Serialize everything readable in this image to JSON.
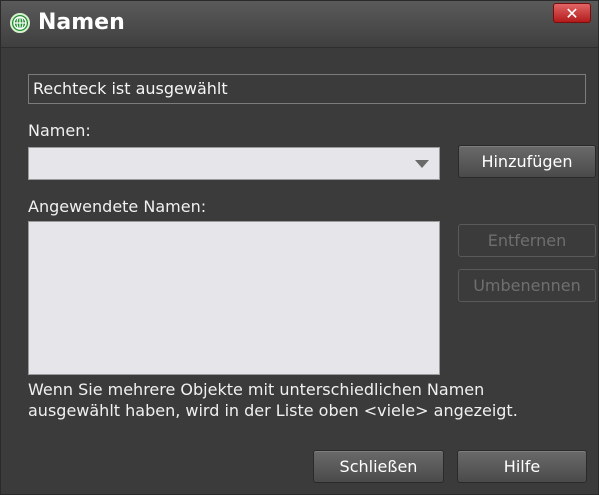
{
  "window": {
    "title": "Namen",
    "close_label": "✕"
  },
  "status": {
    "text": "Rechteck ist ausgewählt"
  },
  "names": {
    "label": "Namen:",
    "combo_value": "",
    "add_button": "Hinzufügen"
  },
  "applied": {
    "label": "Angewendete Namen:",
    "items": [],
    "remove_button": "Entfernen",
    "rename_button": "Umbenennen"
  },
  "info": {
    "line1": "Wenn Sie mehrere Objekte mit unterschiedlichen Namen",
    "line2": "ausgewählt haben, wird in der Liste oben <viele> angezeigt."
  },
  "footer": {
    "close_button": "Schließen",
    "help_button": "Hilfe"
  },
  "colors": {
    "dialog_bg": "#3b3b3b",
    "field_bg": "#e5e5ea",
    "close_red": "#c62828",
    "icon_green": "#1f8f2e"
  }
}
